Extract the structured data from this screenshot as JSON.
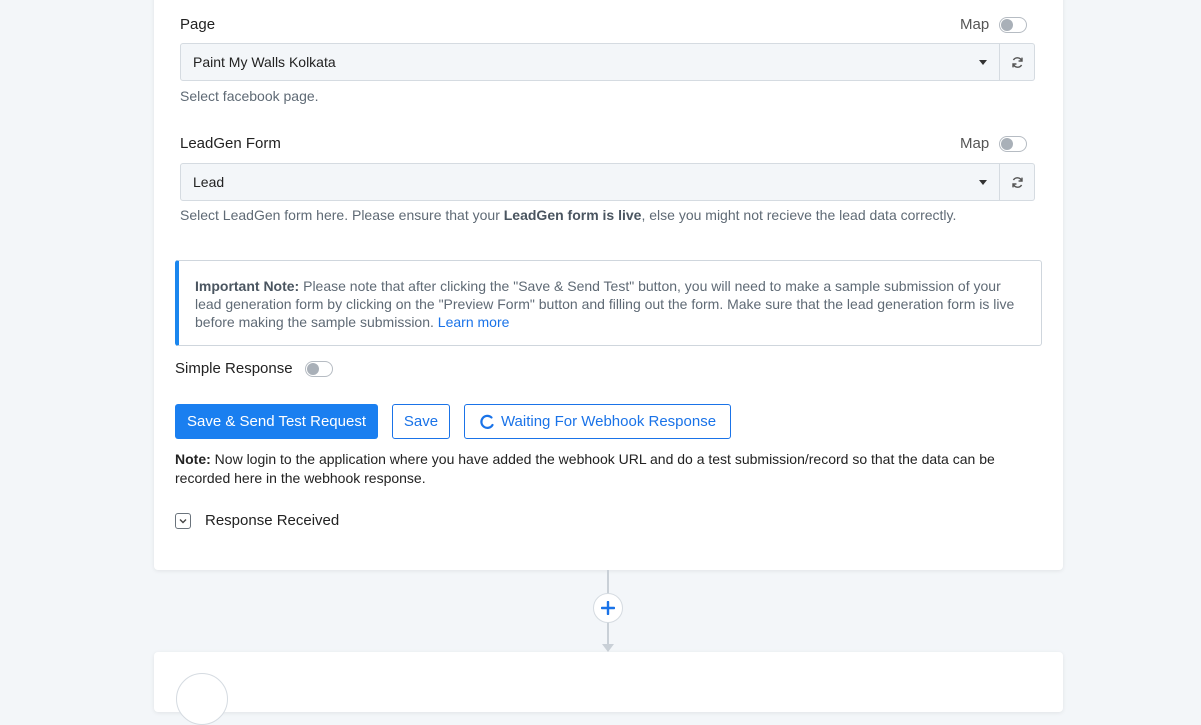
{
  "page_field": {
    "label": "Page",
    "map_label": "Map",
    "selected": "Paint My Walls Kolkata",
    "help": "Select facebook page."
  },
  "leadgen_field": {
    "label": "LeadGen Form",
    "map_label": "Map",
    "selected": "Lead",
    "help_prefix": "Select LeadGen form here. Please ensure that your ",
    "help_bold": "LeadGen form is live",
    "help_suffix": ", else you might not recieve the lead data correctly."
  },
  "important_note": {
    "bold": "Important Note:",
    "text": " Please note that after clicking the \"Save & Send Test\" button, you will need to make a sample submission of your lead generation form by clicking on the \"Preview Form\" button and filling out the form. Make sure that the lead generation form is live before making the sample submission. ",
    "link": "Learn more"
  },
  "simple_response": {
    "label": "Simple Response"
  },
  "buttons": {
    "save_send": "Save & Send Test Request",
    "save": "Save",
    "waiting": "Waiting For Webhook Response"
  },
  "bottom_note": {
    "bold": "Note:",
    "text": " Now login to the application where you have added the webhook URL and do a test submission/record so that the data can be recorded here in the webhook response."
  },
  "response_received": {
    "label": "Response Received"
  },
  "colors": {
    "primary": "#1a7ff0",
    "accent_border": "#1a86ee",
    "link": "#1a73e8"
  }
}
